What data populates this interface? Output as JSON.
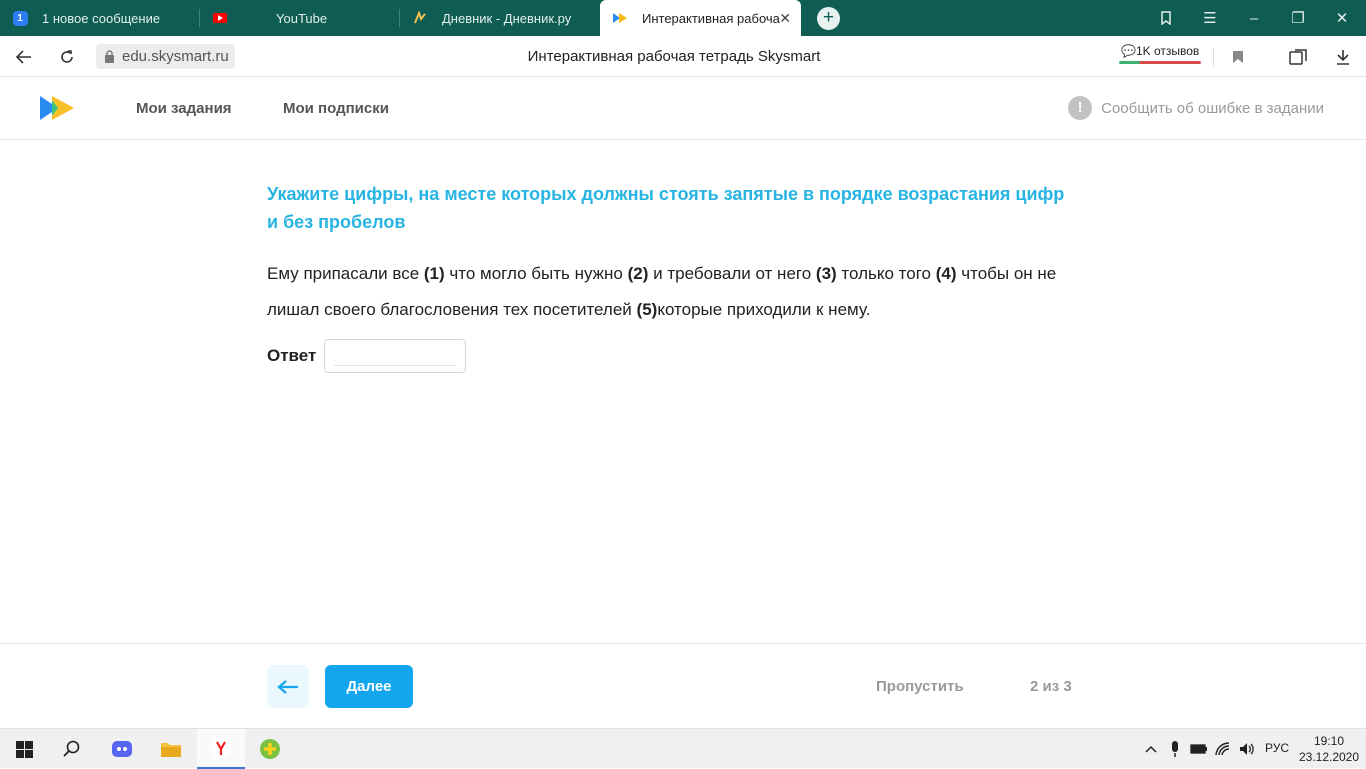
{
  "browser": {
    "tabs": [
      {
        "label": "1 новое сообщение",
        "icon": "vk-badge-icon",
        "badge": "1"
      },
      {
        "label": "YouTube",
        "icon": "youtube-icon"
      },
      {
        "label": "Дневник - Дневник.ру",
        "icon": "dnevnik-icon"
      },
      {
        "label": "Интерактивная рабоча",
        "icon": "skysmart-icon",
        "active": true
      }
    ],
    "new_tab_symbol": "+",
    "url": "edu.skysmart.ru",
    "page_title": "Интерактивная рабочая тетрадь Skysmart",
    "reviews_label": "1K отзывов"
  },
  "site": {
    "nav": {
      "my_tasks": "Мои задания",
      "my_subscriptions": "Мои подписки"
    },
    "report_error": "Сообщить об ошибке в задании",
    "report_icon_glyph": "!"
  },
  "task": {
    "title": "Укажите цифры, на месте которых должны стоять запятые в порядке возрастания цифр и без пробелов",
    "text_parts": [
      {
        "t": "Ему припасали все "
      },
      {
        "b": "(1)"
      },
      {
        "t": " что могло быть нужно "
      },
      {
        "b": "(2)"
      },
      {
        "t": " и требовали от него "
      },
      {
        "b": "(3)"
      },
      {
        "t": " только того "
      },
      {
        "b": "(4)"
      },
      {
        "t": " чтобы он не лишал своего благословения тех посетителей "
      },
      {
        "b": "(5)"
      },
      {
        "t": "которые приходили к нему."
      }
    ],
    "answer_label": "Ответ",
    "answer_value": ""
  },
  "footer": {
    "next_label": "Далее",
    "skip_label": "Пропустить",
    "progress": "2 из 3"
  },
  "taskbar": {
    "language": "РУС",
    "time": "19:10",
    "date": "23.12.2020"
  },
  "colors": {
    "accent": "#13a6ee",
    "title": "#27b4e3",
    "tabstrip": "#0e5c52"
  }
}
